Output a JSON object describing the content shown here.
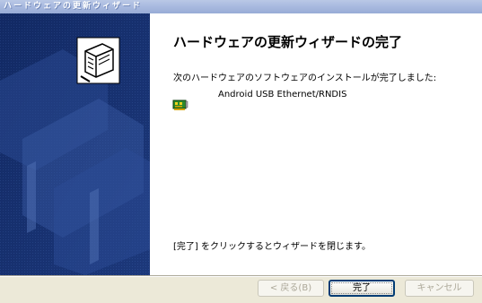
{
  "window": {
    "title": "ハードウェアの更新ウィザード"
  },
  "content": {
    "heading": "ハードウェアの更新ウィザードの完了",
    "intro": "次のハードウェアのソフトウェアのインストールが完了しました:",
    "device": {
      "icon": "network-adapter-icon",
      "name": "Android USB Ethernet/RNDIS"
    },
    "finish_text": "[完了] をクリックするとウィザードを閉じます。"
  },
  "buttons": {
    "back_label": "< 戻る(B)",
    "finish_label": "完了",
    "cancel_label": "キャンセル"
  },
  "colors": {
    "title_bar": "#a8b9df",
    "side_panel": "#16306e",
    "content_bg": "#ffffff",
    "dialog_bg": "#ece9d8",
    "default_button_border": "#003c74"
  }
}
